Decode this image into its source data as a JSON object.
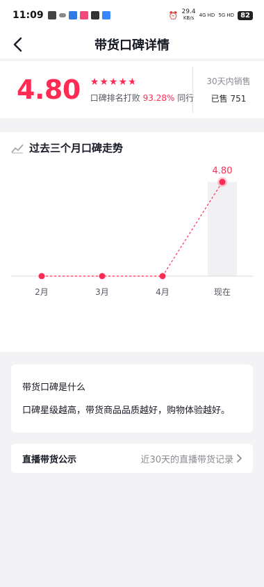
{
  "status_bar": {
    "time": "11:09",
    "net_speed": "29.4",
    "net_unit": "KB/s",
    "signal_a": "4G HD",
    "signal_b": "5G HD",
    "battery": "82"
  },
  "header": {
    "title": "带货口碑详情",
    "back_icon": "chevron-left-icon"
  },
  "summary": {
    "score": "4.80",
    "stars": 4.8,
    "rank_prefix": "口碑排名打败",
    "rank_percent": "93.28%",
    "rank_suffix": "同行",
    "sales_label": "30天内销售",
    "sales_value": "已售 751"
  },
  "trend": {
    "title": "过去三个月口碑走势",
    "title_icon": "trend-line-icon"
  },
  "chart_data": {
    "type": "line",
    "categories": [
      "2月",
      "3月",
      "4月",
      "现在"
    ],
    "values": [
      0,
      0,
      0,
      4.8
    ],
    "data_labels": [
      "",
      "",
      "",
      "4.80"
    ],
    "highlight_category": "现在",
    "line_style": "dashed",
    "color": "#fe2c55"
  },
  "info": {
    "title": "带货口碑是什么",
    "desc": "口碑星级越高，带货商品品质越好，购物体验越好。"
  },
  "broadcast": {
    "label": "直播带货公示",
    "link_text": "近30天的直播带货记录",
    "arrow_icon": "chevron-right-icon"
  },
  "colors": {
    "accent": "#fe2c55",
    "background": "#f3f3f5",
    "card": "#ffffff"
  }
}
